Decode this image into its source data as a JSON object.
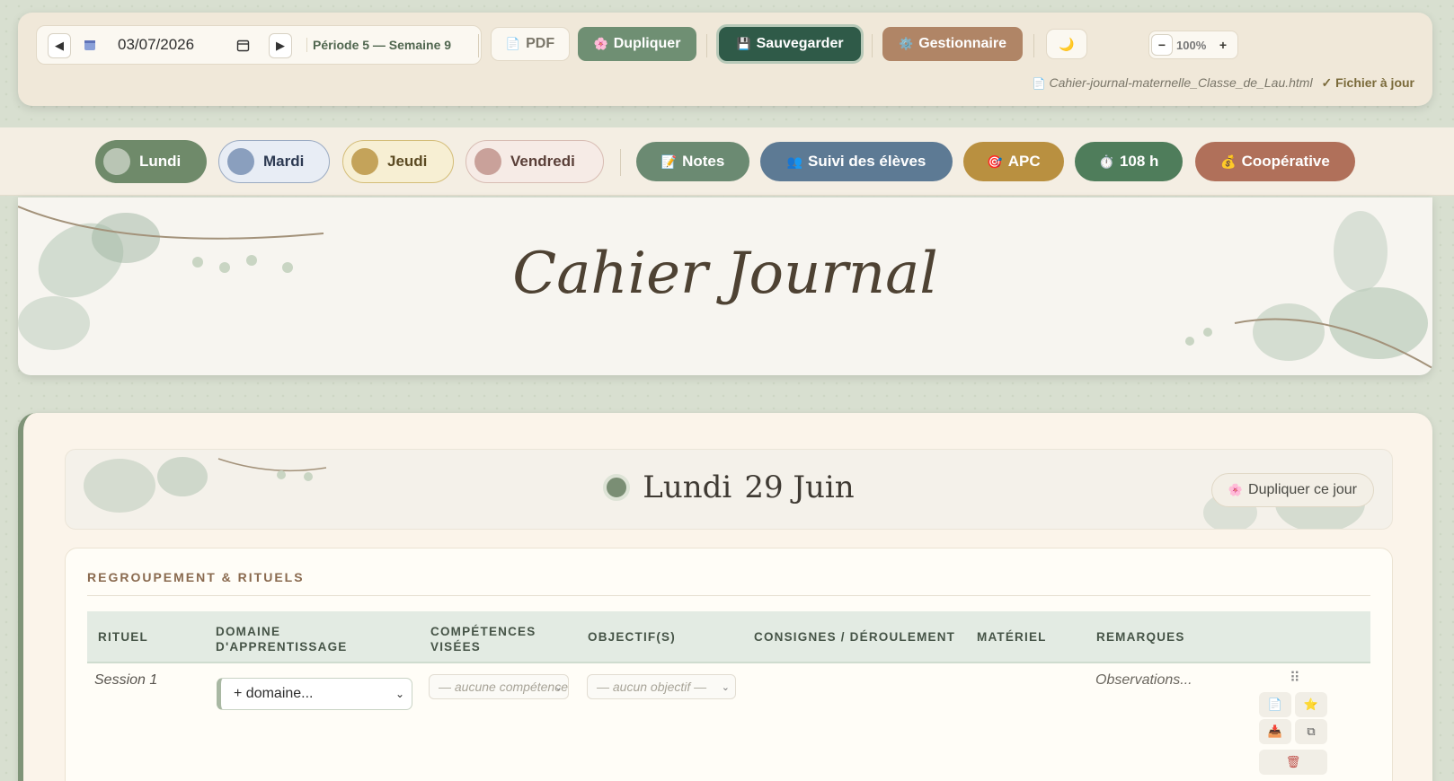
{
  "toolbar": {
    "prev": "◀",
    "next": "▶",
    "date": "03/07/2026",
    "periode": "Période 5 — Semaine 9",
    "pdf": "PDF",
    "dupliquer": "Dupliquer",
    "sauvegarder": "Sauvegarder",
    "gestionnaire": "Gestionnaire",
    "zoom_minus": "−",
    "zoom_value": "100%",
    "zoom_plus": "+",
    "file_name": "Cahier-journal-maternelle_Classe_de_Lau.html",
    "file_status": "✓ Fichier à jour"
  },
  "days": [
    {
      "label": "Lundi",
      "active": true
    },
    {
      "label": "Mardi",
      "active": false
    },
    {
      "label": "Jeudi",
      "active": false
    },
    {
      "label": "Vendredi",
      "active": false
    }
  ],
  "nav": {
    "notes": "Notes",
    "suivi": "Suivi des élèves",
    "apc": "APC",
    "hours": "108 h",
    "coop": "Coopérative"
  },
  "banner": {
    "title": "Cahier Journal"
  },
  "day": {
    "name": "Lundi",
    "date": "29 Juin",
    "duplicate": "Dupliquer ce jour"
  },
  "section": {
    "title": "REGROUPEMENT & RITUELS",
    "columns": [
      "RITUEL",
      "DOMAINE D'APPRENTISSAGE",
      "COMPÉTENCES VISÉES",
      "OBJECTIF(S)",
      "CONSIGNES / DÉROULEMENT",
      "MATÉRIEL",
      "REMARQUES"
    ],
    "row": {
      "session": "Session 1",
      "domaine": "+ domaine...",
      "competences": "— aucune compétence —",
      "objectifs": "— aucun objectif —",
      "remarques": "Observations..."
    }
  },
  "colors": {
    "lundi": "#6f8a6a",
    "mardi": "#8a9fbe",
    "jeudi": "#c4a35a",
    "vendredi": "#c9a19a",
    "notes": "#6b8a72",
    "suivi": "#5d7a94",
    "apc": "#b99040",
    "hours": "#4f7d5b",
    "coop": "#b0705a"
  }
}
